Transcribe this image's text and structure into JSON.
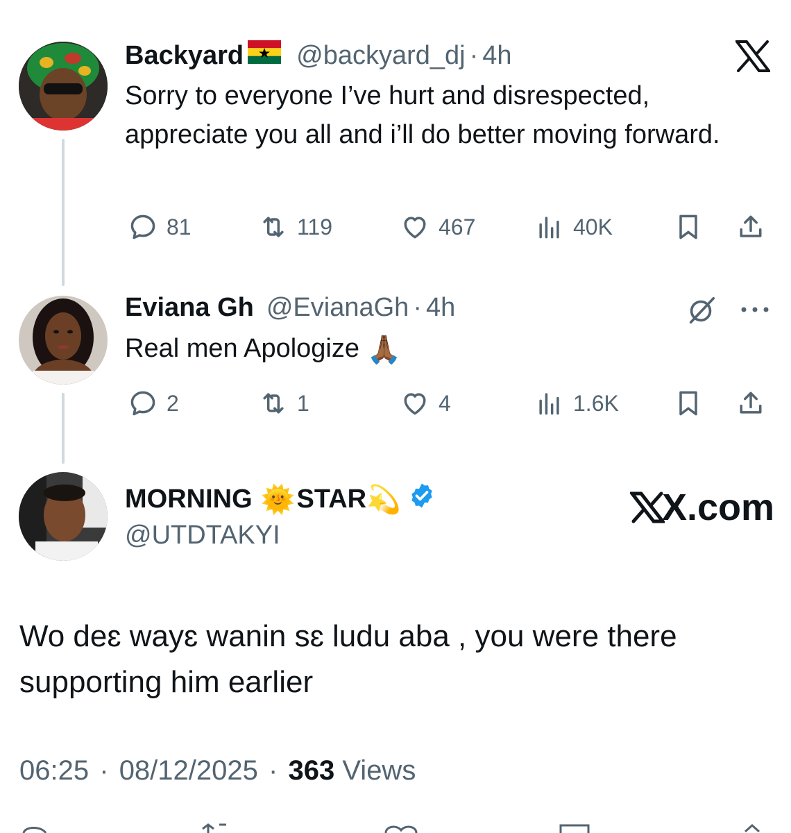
{
  "thread": [
    {
      "name": "Backyard",
      "flag": "🇬🇭",
      "handle": "@backyard_dj",
      "sep": "·",
      "time": "4h",
      "text": "Sorry to everyone I’ve hurt and disrespected, appreciate you all and i’ll do better moving forward.",
      "stats": {
        "replies": "81",
        "reposts": "119",
        "likes": "467",
        "views": "40K"
      }
    },
    {
      "name": "Eviana Gh",
      "handle": "@EvianaGh",
      "sep": "·",
      "time": "4h",
      "text": "Real men Apologize",
      "emoji": "🙏🏾",
      "stats": {
        "replies": "2",
        "reposts": "1",
        "likes": "4",
        "views": "1.6K"
      }
    }
  ],
  "main": {
    "name_part1": "MORNING",
    "name_emoji1": "🌞",
    "name_part2": "STAR",
    "name_emoji2": "💫",
    "handle": "@UTDTAKYI",
    "watermark": "X.com",
    "text": "Wo deɛ wayɛ wanin sɛ ludu aba , you were there supporting him earlier",
    "time": "06:25",
    "date": "08/12/2025",
    "sep": "·",
    "views_count": "363",
    "views_label": "Views"
  },
  "colors": {
    "verified": "#1d9bf0",
    "muted": "#536471",
    "text": "#0f1419",
    "thread_line": "#cfd9de"
  }
}
